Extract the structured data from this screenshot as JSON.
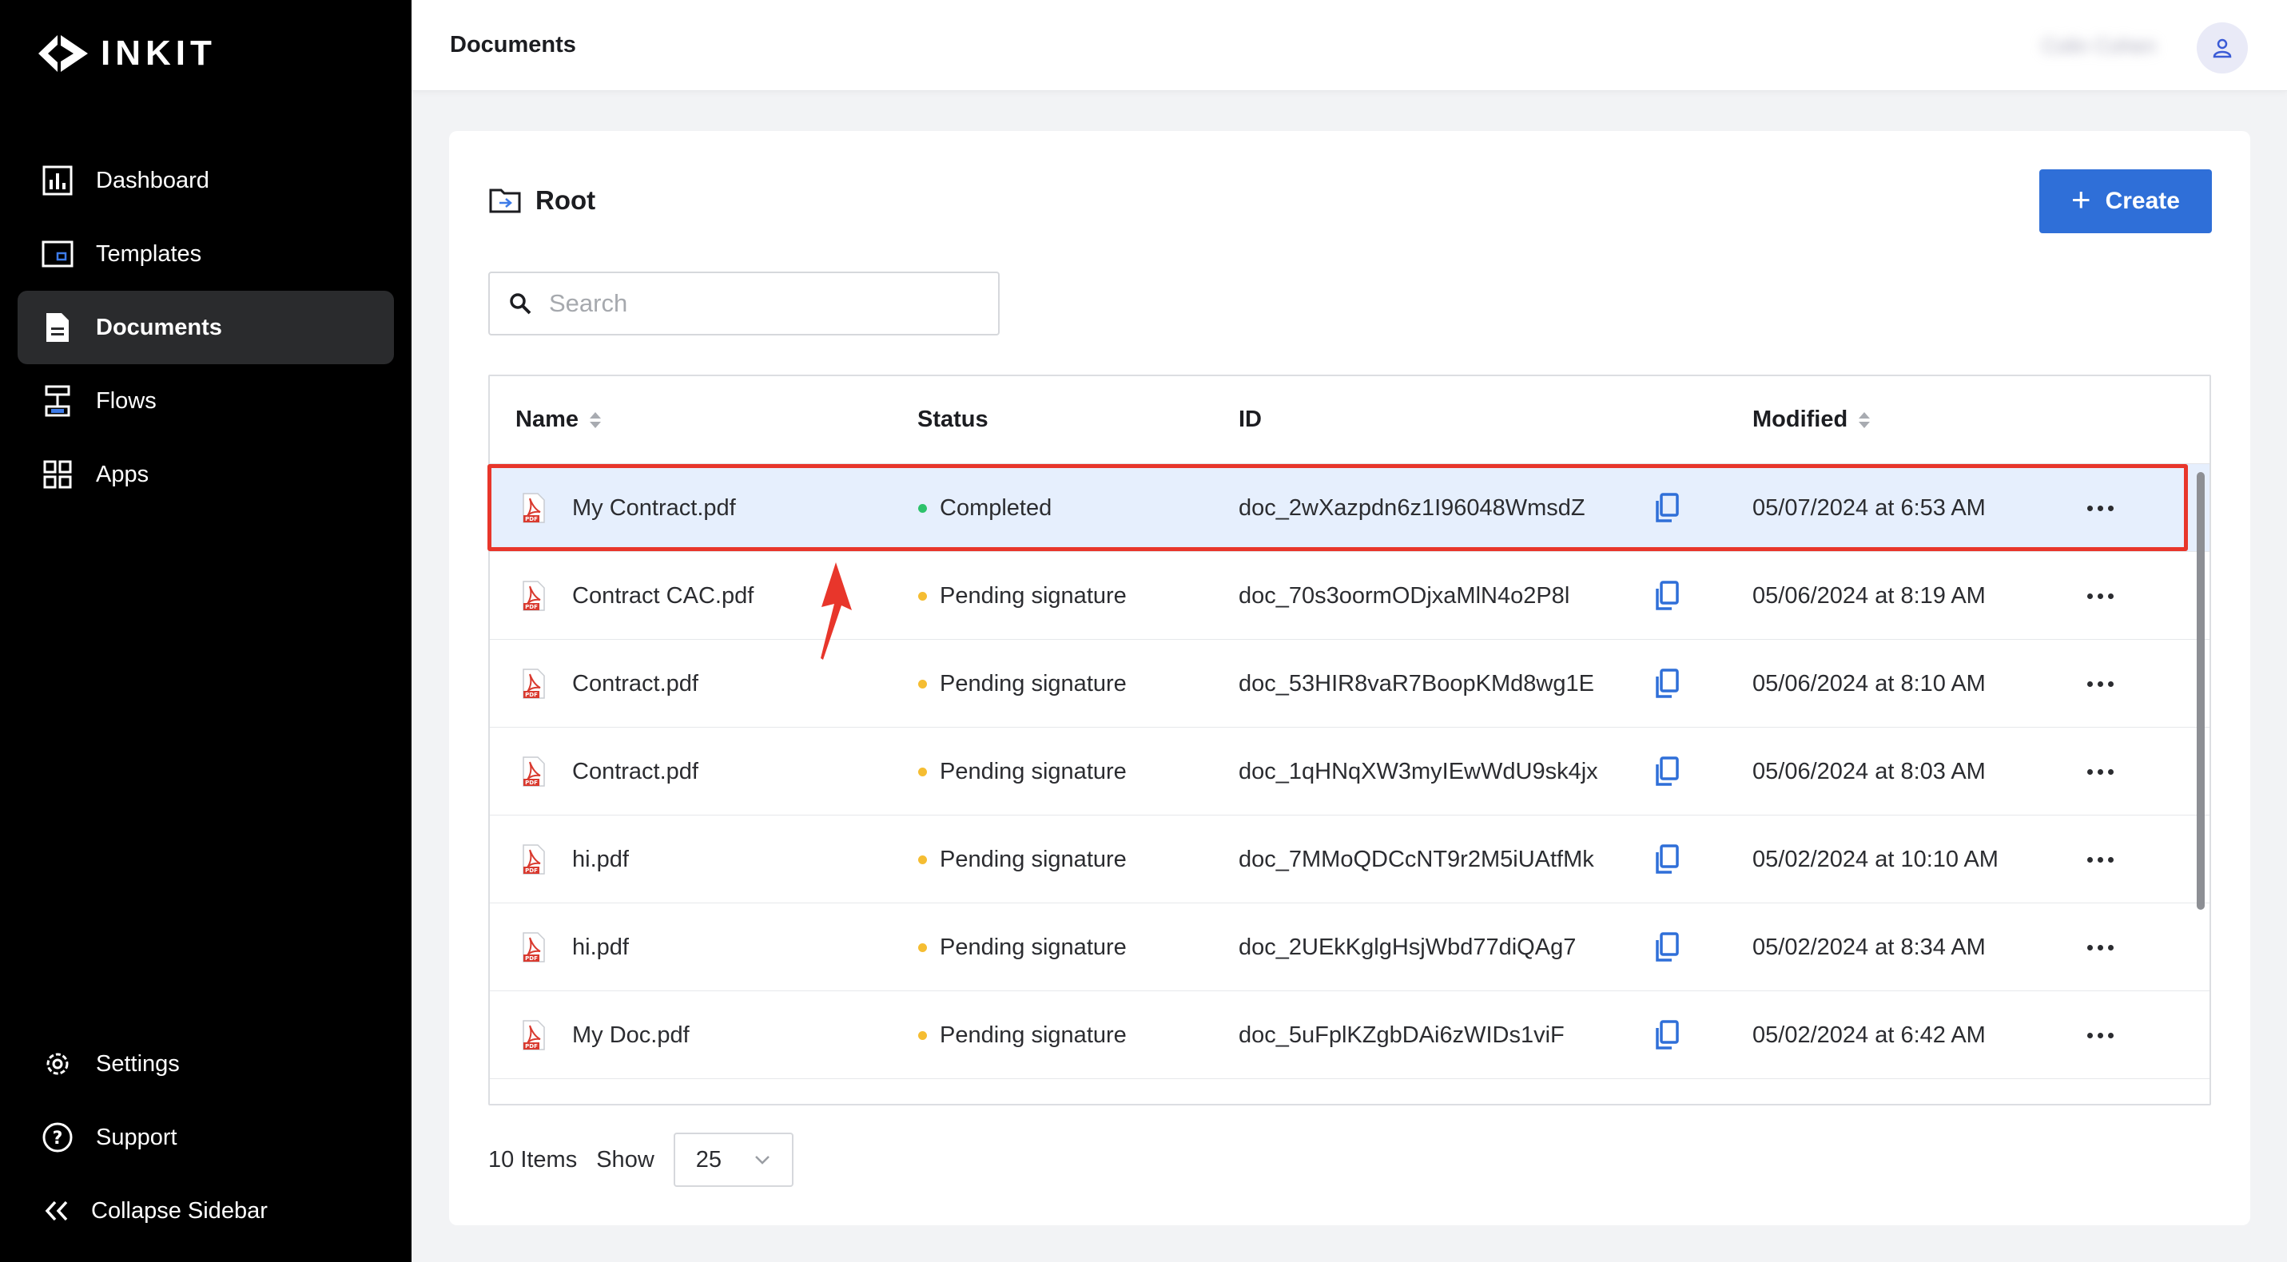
{
  "app": {
    "logo_text": "INKIT"
  },
  "sidebar": {
    "items": [
      {
        "label": "Dashboard",
        "icon": "dashboard-icon"
      },
      {
        "label": "Templates",
        "icon": "templates-icon"
      },
      {
        "label": "Documents",
        "icon": "document-icon",
        "active": true
      },
      {
        "label": "Flows",
        "icon": "flows-icon"
      },
      {
        "label": "Apps",
        "icon": "apps-grid-icon"
      }
    ],
    "bottom": [
      {
        "label": "Settings",
        "icon": "gear-icon"
      },
      {
        "label": "Support",
        "icon": "help-circle-icon"
      },
      {
        "label": "Collapse Sidebar",
        "icon": "chevrons-left-icon"
      }
    ]
  },
  "topbar": {
    "title": "Documents",
    "user_name": "Colin Cohen"
  },
  "folder": {
    "title": "Root",
    "icon": "folder-icon"
  },
  "create_button": {
    "label": "Create"
  },
  "search": {
    "placeholder": "Search",
    "value": ""
  },
  "table": {
    "columns": [
      "Name",
      "Status",
      "ID",
      "Modified"
    ],
    "rows": [
      {
        "name": "My Contract.pdf",
        "status": "Completed",
        "status_color": "#2dc26b",
        "id": "doc_2wXazpdn6z1I96048WmsdZ",
        "modified": "05/07/2024 at 6:53 AM",
        "selected": true
      },
      {
        "name": "Contract CAC.pdf",
        "status": "Pending signature",
        "status_color": "#f5bd32",
        "id": "doc_70s3oormODjxaMlN4o2P8l",
        "modified": "05/06/2024 at 8:19 AM"
      },
      {
        "name": "Contract.pdf",
        "status": "Pending signature",
        "status_color": "#f5bd32",
        "id": "doc_53HIR8vaR7BoopKMd8wg1E",
        "modified": "05/06/2024 at 8:10 AM"
      },
      {
        "name": "Contract.pdf",
        "status": "Pending signature",
        "status_color": "#f5bd32",
        "id": "doc_1qHNqXW3myIEwWdU9sk4jx",
        "modified": "05/06/2024 at 8:03 AM"
      },
      {
        "name": "hi.pdf",
        "status": "Pending signature",
        "status_color": "#f5bd32",
        "id": "doc_7MMoQDCcNT9r2M5iUAtfMk",
        "modified": "05/02/2024 at 10:10 AM"
      },
      {
        "name": "hi.pdf",
        "status": "Pending signature",
        "status_color": "#f5bd32",
        "id": "doc_2UEkKglgHsjWbd77diQAg7",
        "modified": "05/02/2024 at 8:34 AM"
      },
      {
        "name": "My Doc.pdf",
        "status": "Pending signature",
        "status_color": "#f5bd32",
        "id": "doc_5uFplKZgbDAi6zWIDs1viF",
        "modified": "05/02/2024 at 6:42 AM"
      }
    ]
  },
  "footer": {
    "items_count": "10 Items",
    "show_label": "Show",
    "page_size": "25"
  },
  "colors": {
    "accent": "#2f6fd8",
    "selected_row": "#e6effd",
    "highlight": "#e8362b"
  }
}
